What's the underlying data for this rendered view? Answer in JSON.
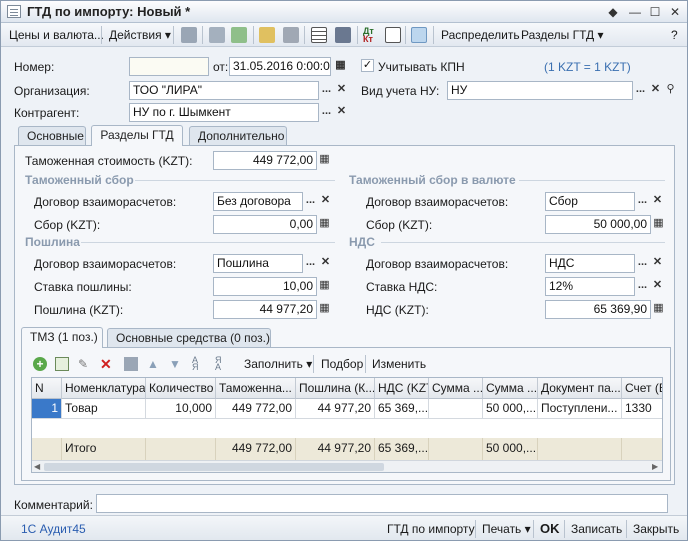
{
  "window": {
    "title": "ГТД по импорту: Новый *"
  },
  "toolbar": {
    "prices_label": "Цены и валюта...",
    "actions_label": "Действия",
    "distribute_label": "Распределить",
    "sections_label": "Разделы ГТД"
  },
  "header": {
    "number_label": "Номер:",
    "number_value": "",
    "date_label": "от:",
    "date_value": "31.05.2016  0:00:00",
    "kpn_label": "Учитывать КПН",
    "rate_text": "(1 KZT = 1 KZT)",
    "org_label": "Организация:",
    "org_value": "ТОО \"ЛИРА\"",
    "nu_label": "Вид учета НУ:",
    "nu_value": "НУ",
    "contractor_label": "Контрагент:",
    "contractor_value": "НУ по г. Шымкент"
  },
  "tabs": [
    "Основные",
    "Разделы ГТД",
    "Дополнительно"
  ],
  "sections": {
    "customs_value_label": "Таможенная стоимость (KZT):",
    "customs_value": "449 772,00",
    "fee_title": "Таможенный сбор",
    "fee_contract_label": "Договор взаиморасчетов:",
    "fee_contract_value": "Без договора",
    "fee_kzt_label": "Сбор (KZT):",
    "fee_kzt_value": "0,00",
    "fee_cur_title": "Таможенный сбор в валюте",
    "fee_cur_contract_label": "Договор взаиморасчетов:",
    "fee_cur_contract_value": "Сбор",
    "fee_cur_kzt_label": "Сбор (KZT):",
    "fee_cur_kzt_value": "50 000,00",
    "duty_title": "Пошлина",
    "duty_contract_label": "Договор взаиморасчетов:",
    "duty_contract_value": "Пошлина",
    "duty_rate_label": "Ставка пошлины:",
    "duty_rate_value": "10,00",
    "duty_kzt_label": "Пошлина (KZT):",
    "duty_kzt_value": "44 977,20",
    "vat_title": "НДС",
    "vat_contract_label": "Договор взаиморасчетов:",
    "vat_contract_value": "НДС",
    "vat_rate_label": "Ставка НДС:",
    "vat_rate_value": "12%",
    "vat_kzt_label": "НДС (KZT):",
    "vat_kzt_value": "65 369,90"
  },
  "subtabs": [
    "ТМЗ (1 поз.)",
    "Основные средства (0 поз.)"
  ],
  "grid_toolbar": {
    "fill_label": "Заполнить",
    "select_label": "Подбор",
    "change_label": "Изменить"
  },
  "grid": {
    "headers": [
      "N",
      "Номенклатура",
      "Количество",
      "Таможенна...",
      "Пошлина (К...",
      "НДС (KZT)",
      "Сумма ...",
      "Сумма ...",
      "Документ па...",
      "Счет (БУ"
    ],
    "row": [
      "1",
      "Товар",
      "10,000",
      "449 772,00",
      "44 977,20",
      "65 369,...",
      "",
      "50 000,...",
      "Поступлени...",
      "1330"
    ],
    "footer": [
      "",
      "Итого",
      "",
      "449 772,00",
      "44 977,20",
      "65 369,...",
      "",
      "50 000,...",
      "",
      ""
    ]
  },
  "comment_label": "Комментарий:",
  "status": {
    "brand": "1С Аудит45",
    "gtd_label": "ГТД по импорту",
    "print_label": "Печать",
    "ok_label": "OK",
    "save_label": "Записать",
    "close_label": "Закрыть"
  }
}
